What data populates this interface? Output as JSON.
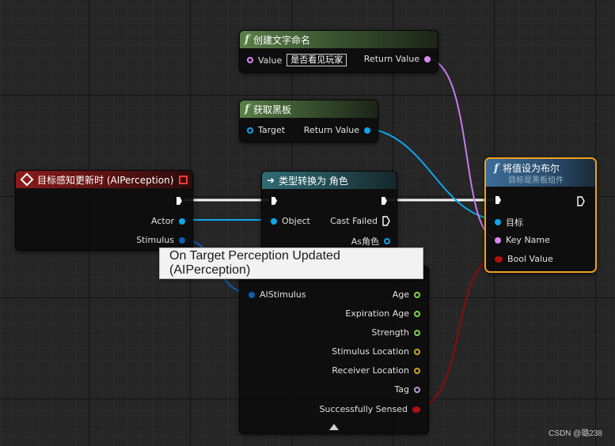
{
  "nodes": {
    "create_text": {
      "title": "创建文字命名",
      "value_label": "Value",
      "value_text": "是否看见玩家",
      "return_label": "Return Value"
    },
    "get_blackboard": {
      "title": "获取黑板",
      "target_label": "Target",
      "return_label": "Return Value"
    },
    "perception_event": {
      "title": "目标感知更新时 (AIPerception)",
      "actor_label": "Actor",
      "stimulus_label": "Stimulus"
    },
    "cast": {
      "title": "类型转换为 角色",
      "object_label": "Object",
      "cast_failed_label": "Cast Failed",
      "as_label": "As角色"
    },
    "set_bool": {
      "title": "将值设为布尔",
      "subtitle": "目标是黑板组件",
      "target_label": "目标",
      "key_name_label": "Key Name",
      "bool_value_label": "Bool Value"
    },
    "break_stimulus": {
      "input_label": "AIStimulus",
      "outputs": [
        "Age",
        "Expiration Age",
        "Strength",
        "Stimulus Location",
        "Receiver Location",
        "Tag",
        "Successfully Sensed"
      ]
    }
  },
  "tooltip": "On Target Perception Updated (AIPerception)",
  "watermark": "CSDN @璐238",
  "colors": {
    "object_pin": "#0ea5e9",
    "name_pin": "#d58af0",
    "bool_pin": "#b01010",
    "float_pin": "#7fd34a",
    "vector_pin": "#d4a21a",
    "selection_outline": "#f0a020"
  }
}
